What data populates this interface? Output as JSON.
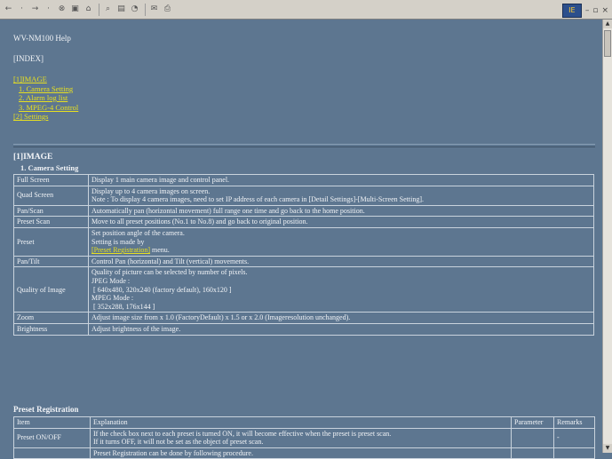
{
  "toolbar": {
    "icons": [
      "back-arrow-icon",
      "forward-arrow-icon",
      "stop-icon",
      "refresh-icon",
      "home-icon",
      "search-icon",
      "favorites-icon",
      "history-icon",
      "mail-icon",
      "print-icon"
    ],
    "win_controls": [
      "–",
      "▫",
      "×"
    ],
    "win_logo": "IE"
  },
  "page": {
    "title": "WV-NM100 Help",
    "index_link": "[INDEX]",
    "nav": [
      {
        "label": "[1]IMAGE",
        "sub": false
      },
      {
        "label": "1. Camera Setting",
        "sub": true
      },
      {
        "label": "2. Alarm log list",
        "sub": true
      },
      {
        "label": "3. MPEG-4 Control",
        "sub": true
      },
      {
        "label": "[2] Settings",
        "sub": false
      }
    ]
  },
  "image_section": {
    "title": "[1]IMAGE",
    "subtitle": "1. Camera Setting",
    "rows": [
      {
        "label": "Full Screen",
        "lines": [
          "Display 1 main camera image and control panel."
        ]
      },
      {
        "label": "Quad Screen",
        "lines": [
          "Display up to 4 camera images on screen.",
          "Note : To display 4 camera images, need to set IP address of each camera in [Detail Settings]-[Multi-Screen Setting]."
        ]
      },
      {
        "label": "Pan/Scan",
        "lines": [
          "Automatically pan (horizontal movement) full range one time and go back to the home position."
        ]
      },
      {
        "label": "Preset Scan",
        "lines": [
          "Move to all preset positions (No.1 to No.8) and go back to original position."
        ]
      },
      {
        "label": "Preset",
        "line1": "Set position angle of the camera.",
        "line2": "Setting is made by",
        "link": "[Preset Registration]",
        "after": " menu."
      },
      {
        "label": "Pan/Tilt",
        "lines": [
          "Control Pan (horizontal) and Tilt (vertical) movements."
        ]
      },
      {
        "label": "Quality of Image",
        "lines": [
          "Quality of picture can be selected by number of pixels.",
          "JPEG Mode :",
          "[ 640x480, 320x240 (factory default), 160x120 ]",
          "MPEG Mode :",
          "[ 352x288, 176x144 ]"
        ]
      },
      {
        "label": "Zoom",
        "lines": [
          "Adjust image size from x 1.0 (FactoryDefault) x 1.5 or x 2.0 (Imageresolution unchanged)."
        ]
      },
      {
        "label": "Brightness",
        "lines": [
          "Adjust brightness of the image."
        ]
      }
    ]
  },
  "preset_registration": {
    "title": "Preset Registration",
    "headers": [
      "Item",
      "Explanation",
      "Parameter",
      "Remarks"
    ],
    "rows": [
      {
        "item": "Preset ON/OFF",
        "line1": "If the check box next to each preset is turned ON, it will become effective when the preset is preset scan.",
        "line2": "If it turns OFF, it will not be set as the object of preset scan.",
        "parameter": "",
        "remarks": "-"
      },
      {
        "item": "",
        "line1": "Preset Registration can be done by following procedure.",
        "line2": "",
        "parameter": "",
        "remarks": ""
      }
    ]
  }
}
